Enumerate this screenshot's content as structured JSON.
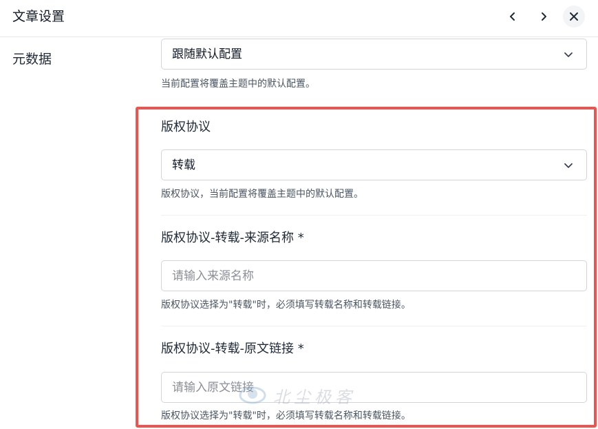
{
  "header": {
    "title": "文章设置",
    "prev_icon": "chevron-left-icon",
    "next_icon": "chevron-right-icon",
    "close_icon": "close-icon"
  },
  "metadata": {
    "label": "元数据",
    "select_value": "跟随默认配置",
    "help": "当前配置将覆盖主题中的默认配置。"
  },
  "copyright": {
    "label": "版权协议",
    "select_value": "转载",
    "help": "版权协议，当前配置将覆盖主题中的默认配置。"
  },
  "source_name": {
    "label": "版权协议-转载-来源名称 *",
    "placeholder": "请输入来源名称",
    "value": "",
    "help": "版权协议选择为\"转载\"时，必须填写转载名称和转载链接。"
  },
  "source_link": {
    "label": "版权协议-转载-原文链接 *",
    "placeholder": "请输入原文链接",
    "value": "",
    "help": "版权协议选择为\"转载\"时，必须填写转载名称和转载链接。"
  },
  "watermark": {
    "text": "北尘极客"
  },
  "colors": {
    "highlight_border": "#ef5350",
    "input_border": "#d1d5db",
    "help_text": "#4b5563"
  }
}
